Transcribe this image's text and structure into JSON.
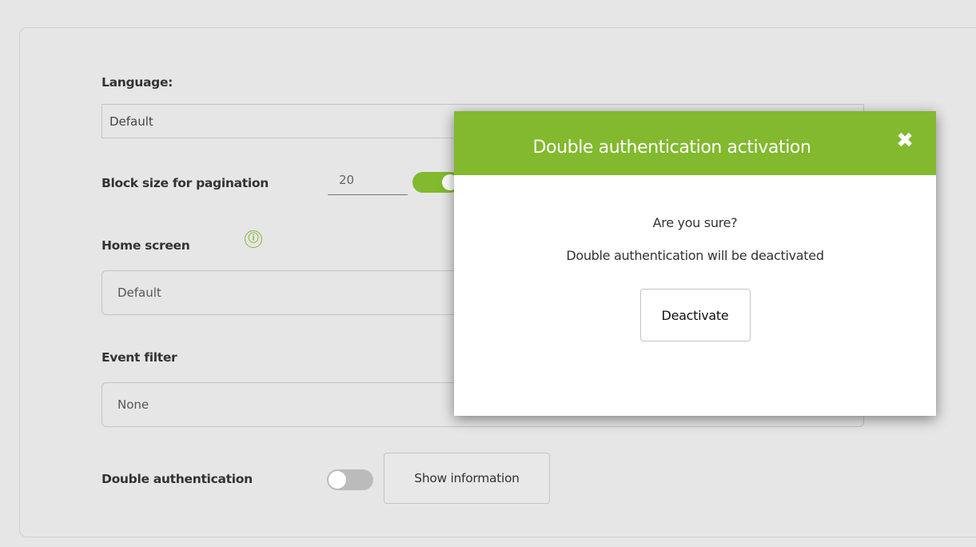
{
  "settings": {
    "language_label": "Language:",
    "language_value": "Default",
    "block_size_label": "Block size for pagination",
    "block_size_value": "20",
    "home_screen_label": "Home screen",
    "home_screen_value": "Default",
    "event_filter_label": "Event filter",
    "event_filter_value": "None",
    "double_auth_label": "Double authentication",
    "show_info_label": "Show information"
  },
  "modal": {
    "title": "Double authentication activation",
    "close_glyph": "✖",
    "question": "Are you sure?",
    "message": "Double authentication will be deactivated",
    "deactivate_label": "Deactivate"
  },
  "icons": {
    "info": "ⓘ"
  },
  "colors": {
    "accent": "#82b92e",
    "background": "#e6e6e6"
  }
}
